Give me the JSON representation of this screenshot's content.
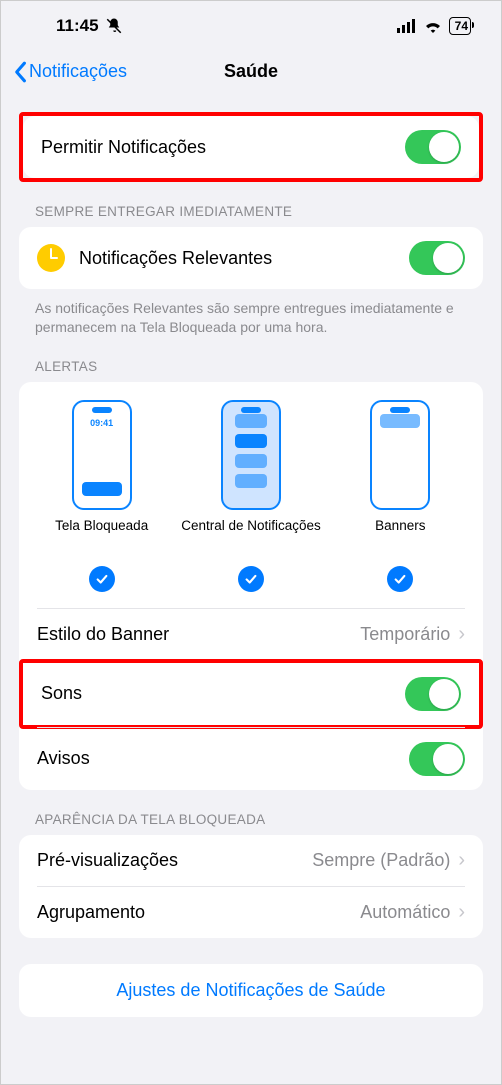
{
  "status": {
    "time": "11:45",
    "battery": "74"
  },
  "nav": {
    "back": "Notificações",
    "title": "Saúde"
  },
  "allow": {
    "label": "Permitir Notificações"
  },
  "deliver": {
    "header": "SEMPRE ENTREGAR IMEDIATAMENTE",
    "relevant_label": "Notificações Relevantes",
    "footer": "As notificações Relevantes são sempre entregues imediatamente e permanecem na Tela Bloqueada por uma hora."
  },
  "alerts": {
    "header": "ALERTAS",
    "lock_time": "09:41",
    "lock_label": "Tela Bloqueada",
    "center_label": "Central de Notificações",
    "banners_label": "Banners",
    "banner_style_label": "Estilo do Banner",
    "banner_style_value": "Temporário",
    "sounds_label": "Sons",
    "badges_label": "Avisos"
  },
  "lockscreen": {
    "header": "APARÊNCIA DA TELA BLOQUEADA",
    "previews_label": "Pré-visualizações",
    "previews_value": "Sempre (Padrão)",
    "grouping_label": "Agrupamento",
    "grouping_value": "Automático"
  },
  "bottom_link": "Ajustes de Notificações de Saúde"
}
